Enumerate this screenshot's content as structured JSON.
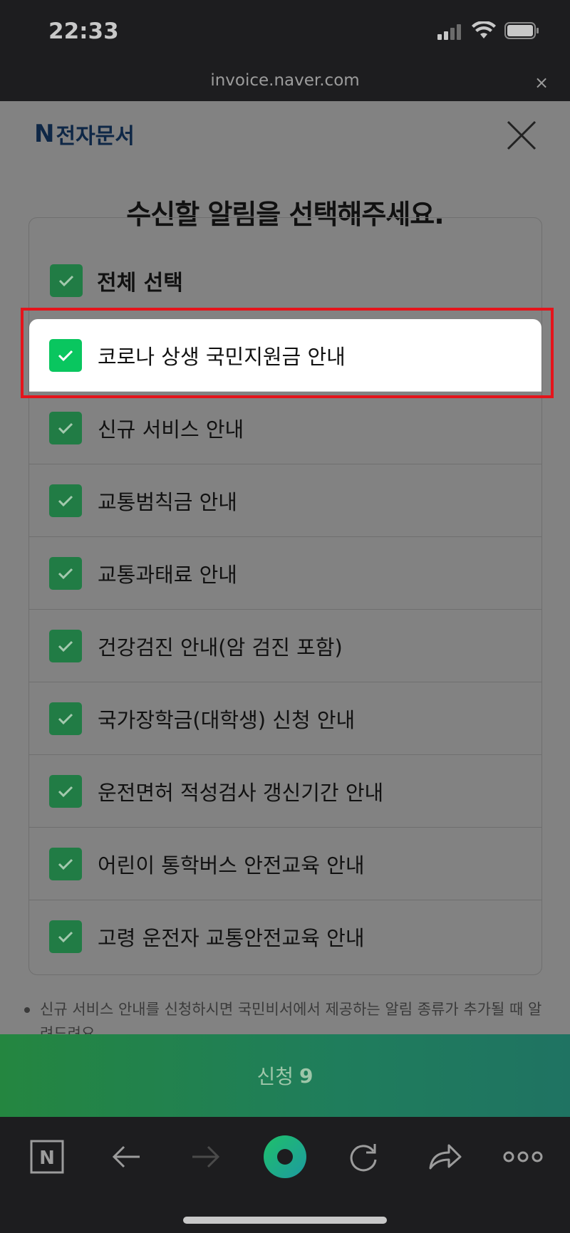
{
  "status_bar": {
    "time": "22:33"
  },
  "url_bar": {
    "url": "invoice.naver.com",
    "close_glyph": "×"
  },
  "header": {
    "brand_letter": "N",
    "brand_name": "전자문서"
  },
  "title": "수신할 알림을 선택해주세요.",
  "select_all": {
    "label": "전체 선택",
    "checked": true
  },
  "items": [
    {
      "label": "코로나 상생 국민지원금 안내",
      "checked": true
    },
    {
      "label": "신규 서비스 안내",
      "checked": true
    },
    {
      "label": "교통범칙금 안내",
      "checked": true
    },
    {
      "label": "교통과태료 안내",
      "checked": true
    },
    {
      "label": "건강검진 안내(암 검진 포함)",
      "checked": true
    },
    {
      "label": "국가장학금(대학생) 신청 안내",
      "checked": true
    },
    {
      "label": "운전면허 적성검사 갱신기간 안내",
      "checked": true
    },
    {
      "label": "어린이 통학버스 안전교육 안내",
      "checked": true
    },
    {
      "label": "고령 운전자 교통안전교육 안내",
      "checked": true
    }
  ],
  "note": "신규 서비스 안내를 신청하시면 국민비서에서 제공하는 알림 종류가 추가될 때 알려드려요.",
  "apply_button": {
    "label": "신청",
    "count": "9"
  },
  "toolbar": {
    "home_letter": "N"
  },
  "colors": {
    "accent_green": "#09c65f",
    "dim_green": "#217c45",
    "highlight_border": "#e5141b"
  },
  "icons": [
    "check-icon",
    "close-icon",
    "naver-home-icon",
    "back-arrow-icon",
    "forward-arrow-icon",
    "naver-green-dot-icon",
    "reload-icon",
    "share-icon",
    "more-icon",
    "wifi-icon",
    "battery-icon",
    "signal-icon"
  ]
}
